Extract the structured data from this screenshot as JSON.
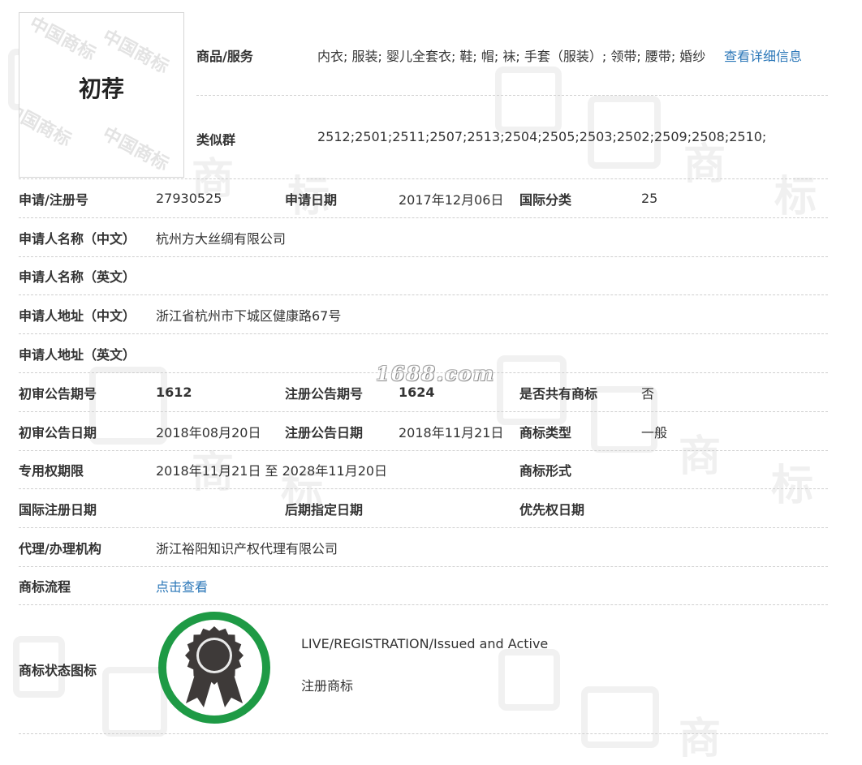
{
  "logo": {
    "text": "初荐",
    "watermark": "中国商标"
  },
  "watermark_site": "1688.com",
  "goods": {
    "label": "商品/服务",
    "value": "内衣; 服装; 婴儿全套衣; 鞋; 帽; 袜; 手套（服装）; 领带; 腰带; 婚纱",
    "detail_link": "查看详细信息"
  },
  "similar_group": {
    "label": "类似群",
    "value": "2512;2501;2511;2507;2513;2504;2505;2503;2502;2509;2508;2510;"
  },
  "rows": {
    "reg_no": {
      "label": "申请/注册号",
      "value": "27930525"
    },
    "app_date": {
      "label": "申请日期",
      "value": "2017年12月06日"
    },
    "intl_class": {
      "label": "国际分类",
      "value": "25"
    },
    "applicant_cn": {
      "label": "申请人名称（中文）",
      "value": "杭州方大丝绸有限公司"
    },
    "applicant_en": {
      "label": "申请人名称（英文）",
      "value": ""
    },
    "address_cn": {
      "label": "申请人地址（中文）",
      "value": "浙江省杭州市下城区健康路67号"
    },
    "address_en": {
      "label": "申请人地址（英文）",
      "value": ""
    },
    "prelim_issue": {
      "label": "初审公告期号",
      "value": "1612"
    },
    "reg_issue": {
      "label": "注册公告期号",
      "value": "1624"
    },
    "shared": {
      "label": "是否共有商标",
      "value": "否"
    },
    "prelim_date": {
      "label": "初审公告日期",
      "value": "2018年08月20日"
    },
    "reg_date": {
      "label": "注册公告日期",
      "value": "2018年11月21日"
    },
    "mark_type": {
      "label": "商标类型",
      "value": "一般"
    },
    "exclusive_period": {
      "label": "专用权期限",
      "value": "2018年11月21日 至 2028年11月20日"
    },
    "mark_form": {
      "label": "商标形式",
      "value": ""
    },
    "intl_reg_date": {
      "label": "国际注册日期",
      "value": ""
    },
    "later_designation": {
      "label": "后期指定日期",
      "value": ""
    },
    "priority_date": {
      "label": "优先权日期",
      "value": ""
    },
    "agent": {
      "label": "代理/办理机构",
      "value": "浙江裕阳知识产权代理有限公司"
    },
    "process": {
      "label": "商标流程",
      "link": "点击查看"
    }
  },
  "status": {
    "label": "商标状态图标",
    "en": "LIVE/REGISTRATION/Issued and Active",
    "cn": "注册商标",
    "ring_color": "#1e9a45",
    "icon": "award-ribbon-icon"
  },
  "colors": {
    "link": "#2b77b8",
    "text": "#333333",
    "divider": "#cfcfcf"
  }
}
